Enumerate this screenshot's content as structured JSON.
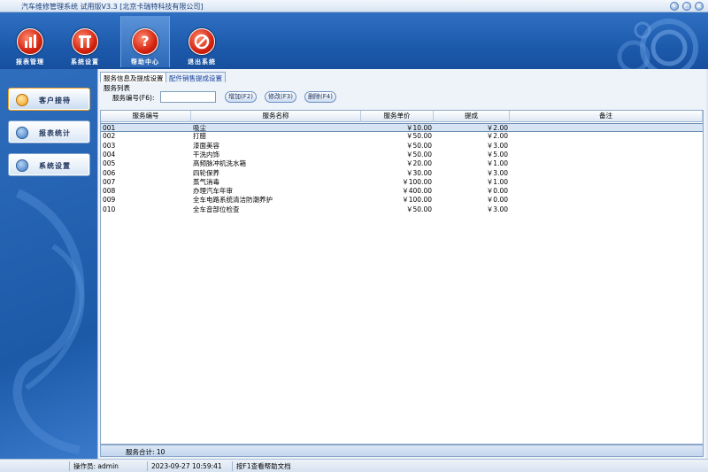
{
  "window": {
    "title": "汽车维修管理系统 试用版V3.3 [北京卡瑞特科技有限公司]"
  },
  "header": {
    "buttons": [
      {
        "label": "报表管理",
        "icon": "bar-chart-icon"
      },
      {
        "label": "系统设置",
        "icon": "tools-icon"
      },
      {
        "label": "帮助中心",
        "icon": "help-icon"
      },
      {
        "label": "退出系统",
        "icon": "exit-icon"
      }
    ]
  },
  "sidebar": {
    "items": [
      {
        "label": "客户接待",
        "active": true
      },
      {
        "label": "报表统计",
        "active": false
      },
      {
        "label": "系统设置",
        "active": false
      }
    ]
  },
  "tabs": [
    {
      "label": "服务信息及提成设置",
      "active": true
    },
    {
      "label": "配件销售提成设置",
      "active": false
    }
  ],
  "group": {
    "title": "服务列表",
    "search_label": "服务编号(F6):",
    "search_value": "",
    "add_label": "增加(F2)",
    "edit_label": "修改(F3)",
    "delete_label": "删除(F4)"
  },
  "table": {
    "columns": [
      "服务编号",
      "服务名称",
      "服务单价",
      "提成",
      "备注"
    ],
    "rows": [
      [
        "001",
        "吸尘",
        "￥10.00",
        "￥2.00",
        ""
      ],
      [
        "002",
        "打腊",
        "￥50.00",
        "￥2.00",
        ""
      ],
      [
        "003",
        "漆面美容",
        "￥50.00",
        "￥3.00",
        ""
      ],
      [
        "004",
        "干洗内饰",
        "￥50.00",
        "￥5.00",
        ""
      ],
      [
        "005",
        "高频脉冲机洗水箱",
        "￥20.00",
        "￥1.00",
        ""
      ],
      [
        "006",
        "四轮保养",
        "￥30.00",
        "￥3.00",
        ""
      ],
      [
        "007",
        "蒸气消毒",
        "￥100.00",
        "￥1.00",
        ""
      ],
      [
        "008",
        "办理汽车年审",
        "￥400.00",
        "￥0.00",
        ""
      ],
      [
        "009",
        "全车电路系统清洁防潮养护",
        "￥100.00",
        "￥0.00",
        ""
      ],
      [
        "010",
        "全车音部位检查",
        "￥50.00",
        "￥3.00",
        ""
      ]
    ],
    "selected_row": 0
  },
  "footer": {
    "total_label": "服务合计: 10"
  },
  "statusbar": {
    "operator": "操作员: admin",
    "datetime": "2023-09-27  10:59:41",
    "help": "按F1查看帮助文档"
  },
  "colors": {
    "header_blue": "#1d5aac",
    "button_red": "#d3220e",
    "active_accent": "#f29b12"
  }
}
